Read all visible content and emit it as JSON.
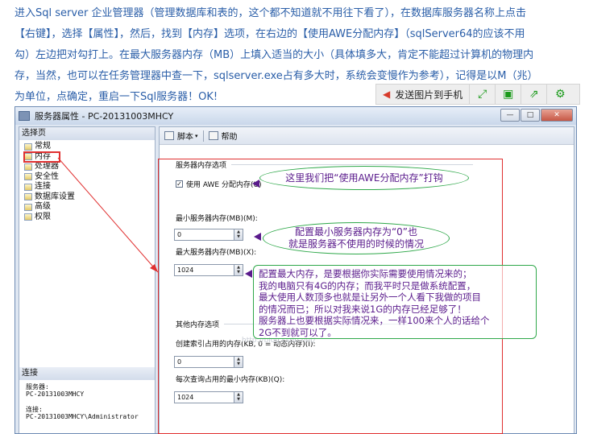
{
  "article": {
    "lines": [
      "进入Sql server 企业管理器（管理数据库和表的，这个都不知道就不用往下看了），在数据库服务器名称上点击",
      "【右键】，选择【属性】，然后，找到【内存】选项，在右边的【使用AWE分配内存】（sqlServer64的应该不用",
      "勾）左边把对勾打上。在最大服务器内存（MB）上填入适当的大小（具体填多大，肯定不能超过计算机的物理内",
      "存，当然，也可以在任务管理器中查一下，sqlserver.exe占有多大时，系统会变慢作为参考），记得是以M（兆）",
      "为单位，点确定，重启一下Sql服务器！OK!"
    ]
  },
  "toolbar": {
    "send_label": "发送图片到手机",
    "icons": [
      "expand-icon",
      "save-icon",
      "share-icon",
      "settings-icon"
    ]
  },
  "window": {
    "title": "服务器属性 - PC-20131003MHCY",
    "buttons": {
      "minimize": "—",
      "maximize": "□",
      "close": "✕"
    },
    "left": {
      "header": "选择页",
      "items": [
        "常规",
        "内存",
        "处理器",
        "安全性",
        "连接",
        "数据库设置",
        "高级",
        "权限"
      ],
      "selected": "内存",
      "conn_header": "连接",
      "server_label": "服务器:",
      "server_value": "PC-20131003MHCY",
      "conn_label": "连接:",
      "conn_value": "PC-20131003MHCY\\Administrator"
    },
    "right": {
      "script": "脚本",
      "help": "帮助",
      "section_memory": "服务器内存选项",
      "awe_label": "使用 AWE 分配内存(U)",
      "awe_checked": true,
      "min_label": "最小服务器内存(MB)(M):",
      "min_value": "0",
      "max_label": "最大服务器内存(MB)(X):",
      "max_value": "1024",
      "section_other": "其他内存选项",
      "index_label": "创建索引占用的内存(KB, 0 = 动态内存)(I):",
      "index_value": "0",
      "query_label": "每次查询占用的最小内存(KB)(Q):",
      "query_value": "1024"
    }
  },
  "annotations": {
    "awe": "这里我们把“使用AWE分配内存”打钩",
    "min": [
      "配置最小服务器内存为“0”也",
      "就是服务器不使用的时候的情况"
    ],
    "max": [
      "配置最大内存，是要根据你实际需要使用情况来的；",
      "我的电脑只有4G的内存；而我平时只是做系统配置，",
      "最大使用人数顶多也就是让另外一个人看下我做的项目",
      "的情况而已；所以对我来说1G的内存已经足够了！",
      "服务器上也要根据实际情况来，一样100来个人的话给个",
      "2G不到就可以了。"
    ]
  },
  "watermark": "http://blog.csdn.net/"
}
